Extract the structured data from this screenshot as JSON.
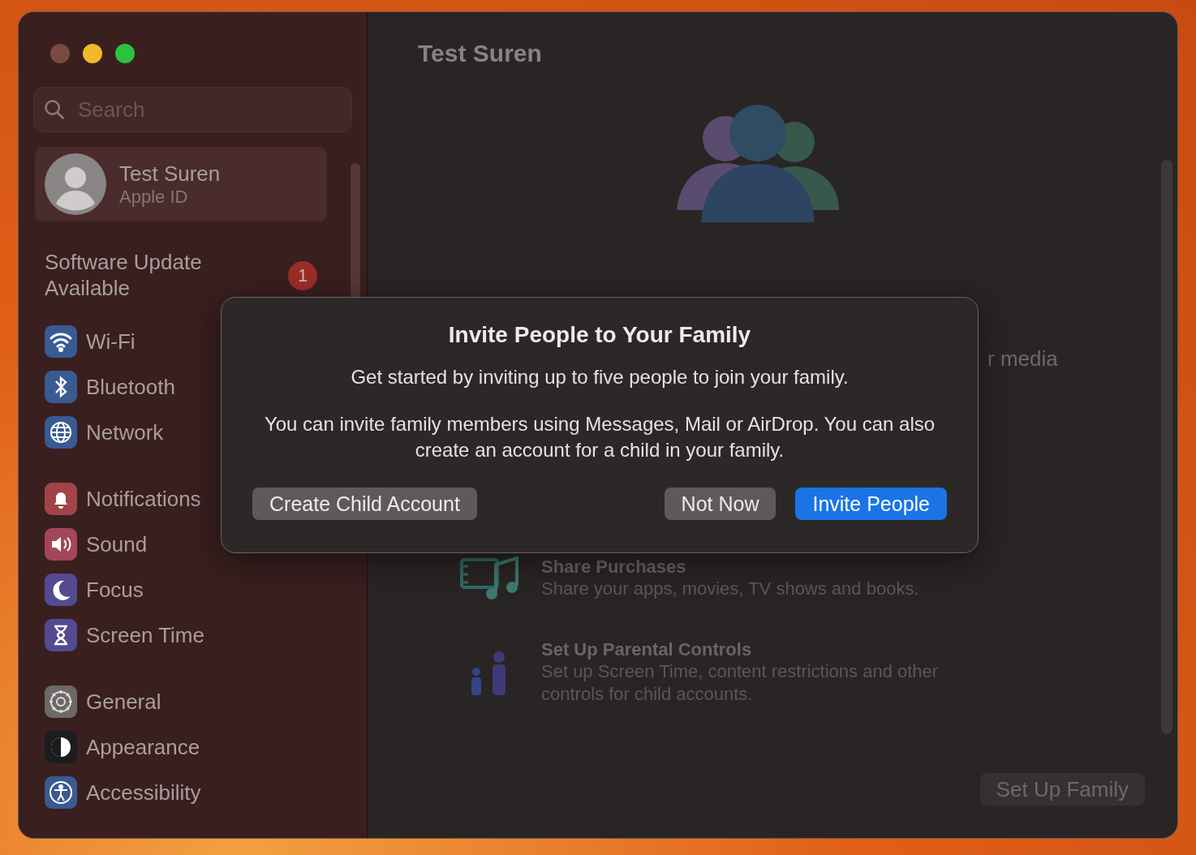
{
  "window": {
    "title": "Test Suren"
  },
  "sidebar": {
    "search": {
      "placeholder": "Search"
    },
    "account": {
      "name": "Test Suren",
      "subtitle": "Apple ID",
      "selected": true
    },
    "update": {
      "label": "Software Update Available",
      "badge": "1"
    },
    "groups": [
      [
        {
          "label": "Wi-Fi",
          "kind": "wifi",
          "color": "#3a5a92",
          "selected": false
        },
        {
          "label": "Bluetooth",
          "kind": "bluetooth",
          "color": "#3a5a92",
          "selected": false
        },
        {
          "label": "Network",
          "kind": "globe",
          "color": "#3a5a92",
          "selected": false
        }
      ],
      [
        {
          "label": "Notifications",
          "kind": "bell",
          "color": "#a04448",
          "selected": false
        },
        {
          "label": "Sound",
          "kind": "speaker",
          "color": "#a2465a",
          "selected": false
        },
        {
          "label": "Focus",
          "kind": "moon",
          "color": "#544a90",
          "selected": false
        },
        {
          "label": "Screen Time",
          "kind": "hourglass",
          "color": "#544a90",
          "selected": false
        }
      ],
      [
        {
          "label": "General",
          "kind": "gear",
          "color": "#6e6868",
          "selected": false
        },
        {
          "label": "Appearance",
          "kind": "contrast",
          "color": "#1c1c1e",
          "selected": false
        },
        {
          "label": "Accessibility",
          "kind": "person",
          "color": "#3a5a92",
          "selected": false
        }
      ]
    ]
  },
  "main": {
    "partial_text": "r media",
    "features": [
      {
        "kind": "film",
        "title": "Share Purchases",
        "text": "Share your apps, movies, TV shows and books."
      },
      {
        "kind": "kids",
        "title": "Set Up Parental Controls",
        "text": "Set up Screen Time, content restrictions and other controls for child accounts."
      }
    ],
    "button": "Set Up Family"
  },
  "dialog": {
    "title": "Invite People to Your Family",
    "text": "Get started by inviting up to five people to join your family.",
    "details": "You can invite family members using Messages, Mail or AirDrop. You can also create an account for a child in your family.",
    "buttons": [
      {
        "label": "Create Child Account",
        "kind": "secondary"
      },
      {
        "label": "Not Now",
        "kind": "secondary"
      },
      {
        "label": "Invite People",
        "kind": "primary"
      }
    ]
  }
}
